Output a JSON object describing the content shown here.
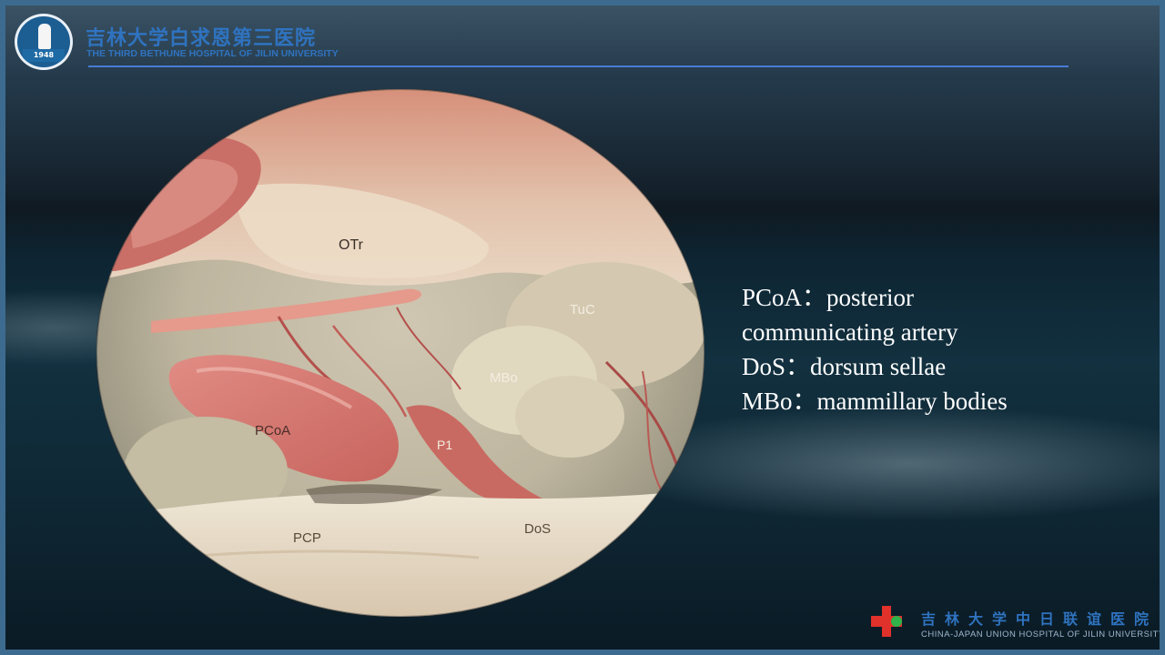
{
  "header": {
    "hospital_cn": "吉林大学白求恩第三医院",
    "hospital_en": "THE THIRD BETHUNE HOSPITAL OF JILIN UNIVERSITY",
    "logo_year": "1948"
  },
  "image_labels": {
    "otr": "OTr",
    "tuc": "TuC",
    "mbo": "MBo",
    "pcoa": "PCoA",
    "p1": "P1",
    "pcp": "PCP",
    "dos": "DoS"
  },
  "legend": {
    "line1": "PCoA：posterior",
    "line2": "communicating artery",
    "line3": "DoS：dorsum sellae",
    "line4": "MBo：mammillary bodies"
  },
  "footer": {
    "hospital_cn": "吉林大学中日联谊医院",
    "hospital_en": "CHINA-JAPAN UNION HOSPITAL OF JILIN UNIVERSITY"
  },
  "colors": {
    "brand_blue": "#2f73c0",
    "frame_blue": "#3d6b8f",
    "logo_red": "#e0312b",
    "logo_green": "#2fb34a"
  }
}
